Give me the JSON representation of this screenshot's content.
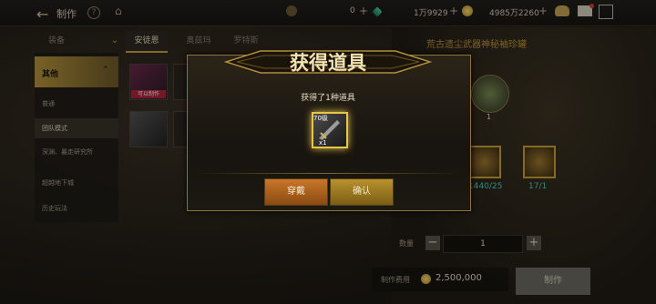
{
  "topbar": {
    "title": "制作",
    "help": "?",
    "res1_value": "0",
    "res2_value": "1万9929",
    "res3_value": "4985万2260"
  },
  "tabs": [
    "装备",
    "安徒恩",
    "奥兹玛",
    "罗特斯"
  ],
  "right_panel": {
    "title": "荒古遗尘武器神秘袖珍罐",
    "pot_count": "1",
    "mat1_value": "1440/25",
    "mat2_value": "17/1",
    "qty_label": "数量",
    "qty_value": "1",
    "cost_label": "制作费用",
    "cost_value": "2,500,000",
    "craft_label": "制作"
  },
  "sidebar": {
    "header": "其他",
    "items": [
      "普通",
      "团队模式",
      "深渊、暴走研究所",
      "超越地下城",
      "历史玩法"
    ]
  },
  "grid": {
    "craftable_label": "可以制作"
  },
  "dialog": {
    "title": "获得道具",
    "subtitle": "获得了1种道具",
    "item_level": "70级",
    "item_count": "x1",
    "equip_label": "穿戴",
    "confirm_label": "确认"
  },
  "colors": {
    "accent": "#c8a146",
    "equip": "#c9772a",
    "confirm": "#b8922f",
    "teal": "#4fd0c4"
  }
}
